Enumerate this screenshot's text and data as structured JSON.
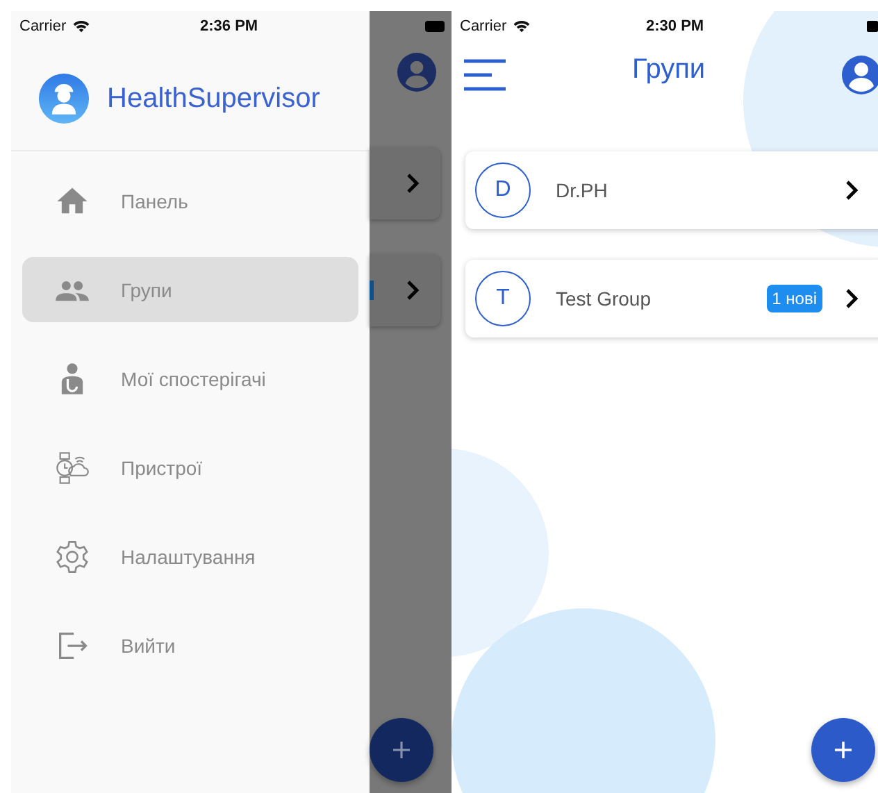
{
  "drawer_screen": {
    "status_bar": {
      "carrier": "Carrier",
      "time": "2:36 PM"
    },
    "app_name": "HealthSupervisor",
    "menu": [
      {
        "label": "Панель",
        "kind": "home",
        "selected": false
      },
      {
        "label": "Групи",
        "kind": "people",
        "selected": true
      },
      {
        "label": "Мої спостерігачі",
        "kind": "doctor",
        "selected": false
      },
      {
        "label": "Пристрої",
        "kind": "devices",
        "selected": false
      },
      {
        "label": "Налаштування",
        "kind": "settings",
        "selected": false
      },
      {
        "label": "Вийти",
        "kind": "logout",
        "selected": false
      }
    ]
  },
  "groups_screen": {
    "status_bar": {
      "carrier": "Carrier",
      "time": "2:30 PM"
    },
    "title": "Групи",
    "groups": [
      {
        "initial": "D",
        "name": "Dr.PH"
      },
      {
        "initial": "T",
        "name": "Test Group",
        "badge": "1 нові"
      }
    ]
  }
}
